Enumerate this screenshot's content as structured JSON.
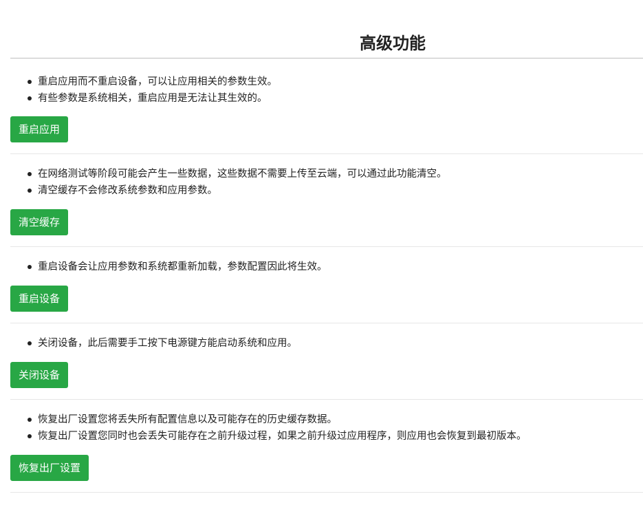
{
  "page": {
    "title": "高级功能"
  },
  "sections": [
    {
      "bullets": [
        "重启应用而不重启设备，可以让应用相关的参数生效。",
        "有些参数是系统相关，重启应用是无法让其生效的。"
      ],
      "button_label": "重启应用"
    },
    {
      "bullets": [
        "在网络测试等阶段可能会产生一些数据，这些数据不需要上传至云端，可以通过此功能清空。",
        "清空缓存不会修改系统参数和应用参数。"
      ],
      "button_label": "清空缓存"
    },
    {
      "bullets": [
        "重启设备会让应用参数和系统都重新加载，参数配置因此将生效。"
      ],
      "button_label": "重启设备"
    },
    {
      "bullets": [
        "关闭设备，此后需要手工按下电源键方能启动系统和应用。"
      ],
      "button_label": "关闭设备"
    },
    {
      "bullets": [
        "恢复出厂设置您将丢失所有配置信息以及可能存在的历史缓存数据。",
        "恢复出厂设置您同时也会丢失可能存在之前升级过程，如果之前升级过应用程序，则应用也会恢复到最初版本。"
      ],
      "button_label": "恢复出厂设置"
    }
  ],
  "colors": {
    "button_bg": "#28a745",
    "button_text": "#ffffff"
  }
}
